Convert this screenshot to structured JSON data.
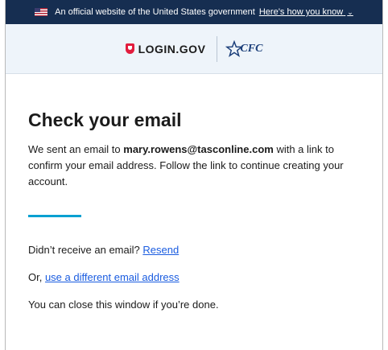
{
  "gov_banner": {
    "text": "An official website of the United States government",
    "link": "Here’s how you know"
  },
  "header": {
    "login_logo_text": "LOGIN.GOV",
    "partner_logo_text": "CFC"
  },
  "main": {
    "title": "Check your email",
    "message_part1": "We sent an email to ",
    "email": "mary.rowens@tasconline.com",
    "message_part2": " with a link to confirm your email address. Follow the link to continue creating your account.",
    "resend_prompt": "Didn’t receive an email?",
    "resend_link": "Resend",
    "different_prefix": "Or, ",
    "different_link": "use a different email address",
    "close_text": "You can close this window if you’re done."
  },
  "colors": {
    "banner_bg": "#162e51",
    "header_bg": "#eef4fa",
    "accent": "#00a0d1",
    "link": "#1a5ce0",
    "login_red": "#e21c3d"
  }
}
